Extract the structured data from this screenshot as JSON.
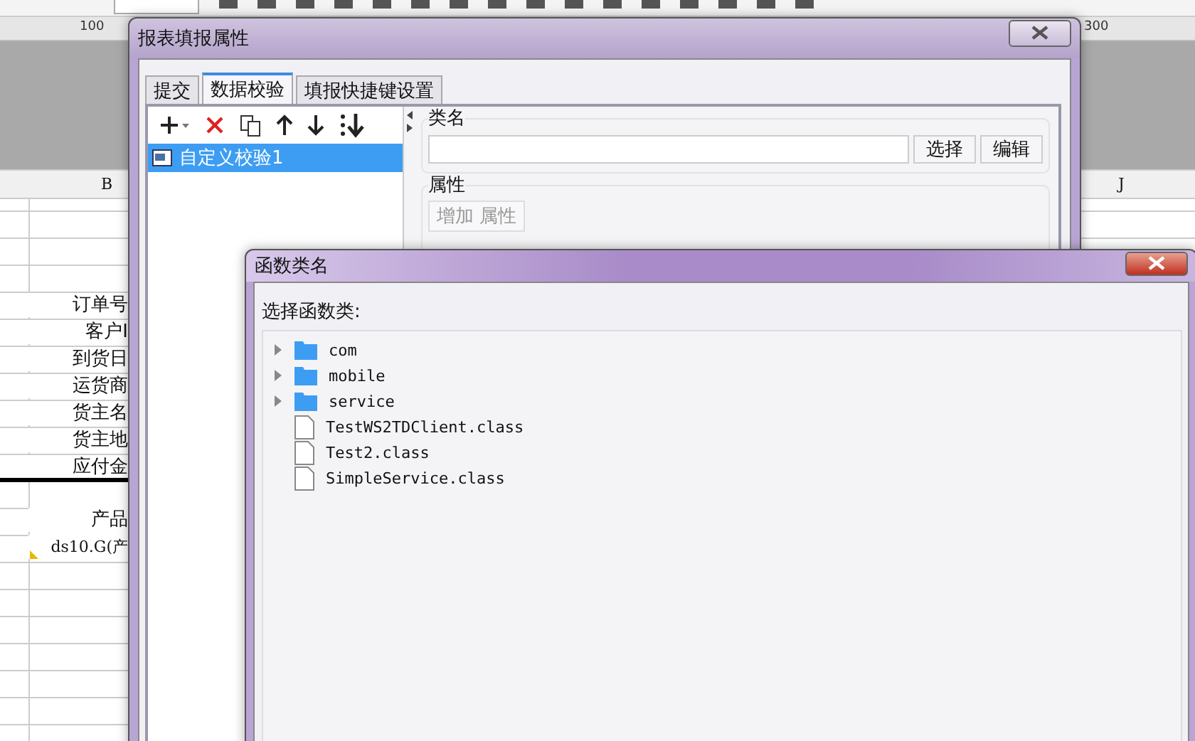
{
  "ruler": {
    "labels": [
      "100",
      "300"
    ]
  },
  "sheet": {
    "column_headers": [
      "B",
      "J"
    ],
    "field_labels": [
      "订单号",
      "客户I",
      "到货日",
      "运货商",
      "货主名",
      "货主地",
      "应付金"
    ],
    "product_header": "产品",
    "formula_cell": "ds10.G(产"
  },
  "report_dialog": {
    "title": "报表填报属性",
    "tabs": [
      {
        "label": "提交",
        "selected": false
      },
      {
        "label": "数据校验",
        "selected": true
      },
      {
        "label": "填报快捷键设置",
        "selected": false
      }
    ],
    "rules": [
      {
        "label": "自定义校验1",
        "selected": true
      }
    ],
    "class_group": {
      "label": "类名",
      "buttons": [
        "选择",
        "编辑"
      ]
    },
    "properties_group": {
      "label": "属性",
      "add_button": {
        "label": "增加 属性",
        "disabled": true
      }
    }
  },
  "function_dialog": {
    "title": "函数类名",
    "prompt": "选择函数类:",
    "tree": [
      {
        "label": "com",
        "kind": "folder",
        "expanded": false
      },
      {
        "label": "mobile",
        "kind": "folder",
        "expanded": false
      },
      {
        "label": "service",
        "kind": "folder",
        "expanded": false
      },
      {
        "label": "TestWS2TDClient.class",
        "kind": "file"
      },
      {
        "label": "Test2.class",
        "kind": "file"
      },
      {
        "label": "SimpleService.class",
        "kind": "file"
      }
    ]
  }
}
